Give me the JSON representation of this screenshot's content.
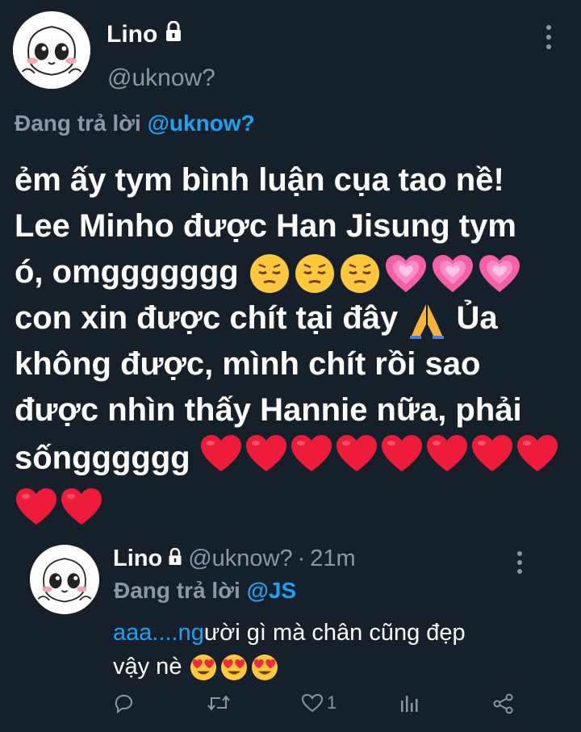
{
  "tweet": {
    "display_name": "Lino",
    "handle": "@uknow?",
    "replying_prefix": "Đang trả lời",
    "replying_mention": "@uknow?",
    "lines": [
      "ẻm ấy tym bình luận cụa tao nề!",
      "Lee Minho được Han Jisung tym",
      "ó, omggggggg",
      "con xin được chít tại đây",
      "không được, mình chít rồi sao",
      "được nhìn thấy Hannie nữa, phải",
      "sốngggggg"
    ],
    "line4_suffix": "Ủa",
    "emoji": {
      "pensive": "pensive-face",
      "heart_pink": "growing-heart",
      "pray": "folded-hands",
      "heart_red": "red-heart"
    }
  },
  "reply": {
    "display_name": "Lino",
    "handle": "@uknow?",
    "dot": "·",
    "time": "21m",
    "replying_prefix": "Đang trả lời",
    "replying_mention": "@JS",
    "text_link": "aaa....ng",
    "text_rest": "ười gì mà chân cũng đẹp",
    "text_line2": "vậy nè",
    "like_count": "1"
  },
  "colors": {
    "background": "#15202b",
    "secondary_text": "#8899a6",
    "accent": "#1da1f2"
  },
  "icons": {
    "lock": "lock-icon",
    "more": "more-vertical-icon",
    "reply": "comment-icon",
    "retweet": "retweet-icon",
    "like": "heart-outline-icon",
    "analytics": "analytics-icon",
    "share": "share-icon"
  }
}
